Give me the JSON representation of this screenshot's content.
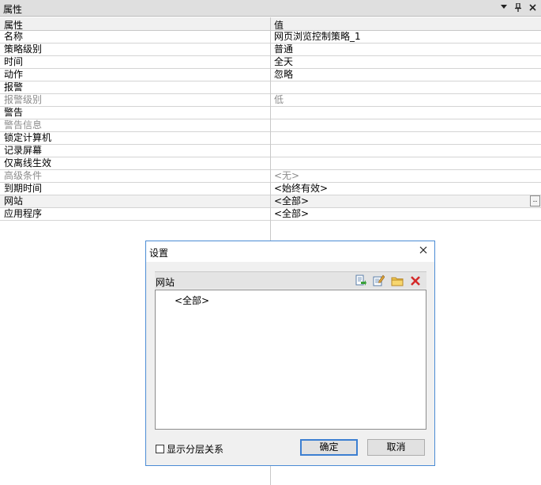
{
  "panel": {
    "title": "属性",
    "icons": [
      "dropdown-arrow-icon",
      "pin-icon",
      "close-icon"
    ]
  },
  "grid": {
    "headers": {
      "name": "属性",
      "value": "值"
    },
    "rows": [
      {
        "name": "名称",
        "value": "网页浏览控制策略_1",
        "disabled": false
      },
      {
        "name": "策略级别",
        "value": "普通",
        "disabled": false
      },
      {
        "name": "时间",
        "value": "全天",
        "disabled": false
      },
      {
        "name": "动作",
        "value": "忽略",
        "disabled": false
      },
      {
        "name": "报警",
        "value": "",
        "disabled": false
      },
      {
        "name": "报警级别",
        "value": "低",
        "disabled": true
      },
      {
        "name": "警告",
        "value": "",
        "disabled": false
      },
      {
        "name": "警告信息",
        "value": "",
        "disabled": true
      },
      {
        "name": "锁定计算机",
        "value": "",
        "disabled": false
      },
      {
        "name": "记录屏幕",
        "value": "",
        "disabled": false
      },
      {
        "name": "仅离线生效",
        "value": "",
        "disabled": false
      },
      {
        "name": "高级条件",
        "value": "<无>",
        "disabled": true
      },
      {
        "name": "到期时间",
        "value": "<始终有效>",
        "disabled": false
      },
      {
        "name": "网站",
        "value": "<全部>",
        "disabled": false,
        "selected": true,
        "has_button": true,
        "button_label": ".."
      },
      {
        "name": "应用程序",
        "value": "<全部>",
        "disabled": false
      }
    ]
  },
  "dialog": {
    "title": "设置",
    "section_label": "网站",
    "tools": [
      "import-icon",
      "edit-icon",
      "folder-icon",
      "delete-icon"
    ],
    "list_items": [
      "<全部>"
    ],
    "checkbox_label": "显示分层关系",
    "checkbox_checked": false,
    "ok_label": "确定",
    "cancel_label": "取消"
  }
}
